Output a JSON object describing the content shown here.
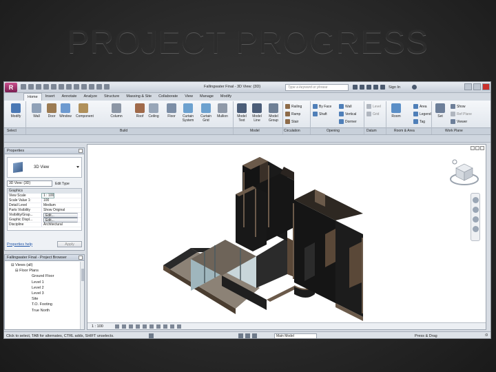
{
  "slide": {
    "title": "PROJECT PROGRESS"
  },
  "app": {
    "logo_letter": "R",
    "doc_title": "Fallingwater Final - 3D View: {3D}",
    "search_placeholder": "Type a keyword or phrase",
    "sign_in": "Sign In",
    "tabs": [
      "Home",
      "Insert",
      "Annotate",
      "Analyze",
      "Structure",
      "Massing & Site",
      "Collaborate",
      "View",
      "Manage",
      "Modify"
    ],
    "active_tab": "Home"
  },
  "ribbon": {
    "tools": [
      {
        "label": "Modify",
        "icon": "cursor-icon",
        "color": "#4a78b5"
      },
      {
        "label": "Wall",
        "icon": "wall-icon",
        "color": "#8fa1b8"
      },
      {
        "label": "Door",
        "icon": "door-icon",
        "color": "#9c7b52"
      },
      {
        "label": "Window",
        "icon": "window-icon",
        "color": "#6d9ad0"
      },
      {
        "label": "Component",
        "icon": "component-icon",
        "color": "#b0905a"
      },
      {
        "label": "Column",
        "icon": "column-icon",
        "color": "#8c96a5"
      },
      {
        "label": "Roof",
        "icon": "roof-icon",
        "color": "#a06a4a"
      },
      {
        "label": "Ceiling",
        "icon": "ceiling-icon",
        "color": "#98a6b8"
      },
      {
        "label": "Floor",
        "icon": "floor-icon",
        "color": "#7c8ea6"
      },
      {
        "label": "Curtain System",
        "icon": "curtain-system-icon",
        "color": "#6ca1cf"
      },
      {
        "label": "Curtain Grid",
        "icon": "curtain-grid-icon",
        "color": "#6ca1cf"
      },
      {
        "label": "Mullion",
        "icon": "mullion-icon",
        "color": "#8f99a8"
      },
      {
        "label": "Model Text",
        "icon": "model-text-icon",
        "color": "#4b5d78"
      },
      {
        "label": "Model Line",
        "icon": "model-line-icon",
        "color": "#4b5d78"
      },
      {
        "label": "Model Group",
        "icon": "model-group-icon",
        "color": "#6f8096"
      }
    ],
    "circulation": [
      "Railing",
      "Ramp",
      "Stair"
    ],
    "opening": [
      "By Face",
      "Shaft",
      "Wall",
      "Vertical",
      "Dormer"
    ],
    "datum": [
      "Level",
      "Grid"
    ],
    "room_area": [
      "Room",
      "Area",
      "Legend",
      "Tag"
    ],
    "work_plane": [
      "Set",
      "Show",
      "Ref Plane",
      "Viewer"
    ],
    "panels": [
      "Select",
      "Build",
      "Model",
      "Circulation",
      "Opening",
      "Datum",
      "Room & Area",
      "Work Plane"
    ]
  },
  "properties": {
    "header": "Properties",
    "type_name": "3D View",
    "instance_select": "3D View: {3D}",
    "edit_type": "Edit Type",
    "category": "Graphics",
    "rows": [
      {
        "name": "View Scale",
        "value": "1 : 100"
      },
      {
        "name": "Scale Value    1:",
        "value": "100"
      },
      {
        "name": "Detail Level",
        "value": "Medium"
      },
      {
        "name": "Parts Visibility",
        "value": "Show Original"
      },
      {
        "name": "Visibility/Grap...",
        "value": "Edit..."
      },
      {
        "name": "Graphic Displ...",
        "value": "Edit..."
      },
      {
        "name": "Discipline",
        "value": "Architectural"
      }
    ],
    "help_link": "Properties help",
    "apply": "Apply"
  },
  "browser": {
    "header": "Fallingwater Final - Project Browser",
    "items": [
      {
        "label": "⊟ Views (all)",
        "indent": 0
      },
      {
        "label": "⊟ Floor Plans",
        "indent": 1
      },
      {
        "label": "Ground Floor",
        "indent": 2
      },
      {
        "label": "Level 1",
        "indent": 2
      },
      {
        "label": "Level 2",
        "indent": 2
      },
      {
        "label": "Level 3",
        "indent": 2
      },
      {
        "label": "Site",
        "indent": 2
      },
      {
        "label": "T.O. Footing",
        "indent": 2
      },
      {
        "label": "True North",
        "indent": 2
      }
    ]
  },
  "viewport": {
    "scale": "1 : 100"
  },
  "status": {
    "message": "Click to select, TAB for alternates, CTRL adds, SHIFT unselects.",
    "workset": "Main Model",
    "press_drag": "Press & Drag",
    "filter_count": ":0"
  },
  "colors": {
    "wall_dark": "#1d1d1d",
    "stone": "#6b5a4a",
    "glass": "#a9bfc6",
    "floor": "#8a7c6c"
  }
}
